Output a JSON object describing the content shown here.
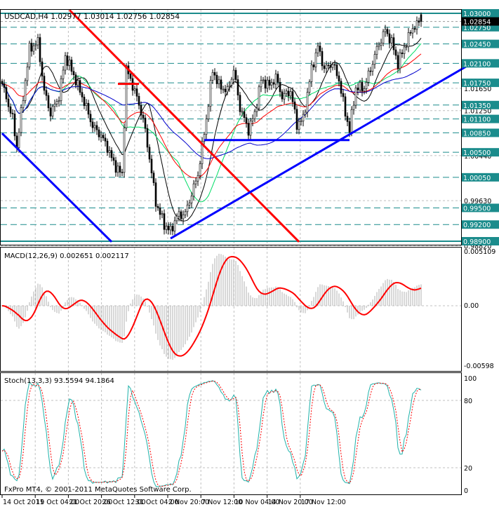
{
  "header": {
    "symbol": "USDCAD,H4",
    "open": "1.02977",
    "high": "1.03014",
    "low": "1.02756",
    "close": "1.02854"
  },
  "macd": {
    "label": "MACD(12,26,9) 0.002651 0.002117",
    "axis": [
      "0.005109",
      "0.00",
      "-0.00598"
    ]
  },
  "stoch": {
    "label": "Stoch(13,3,3) 93.5594 94.1864",
    "axis": [
      "100",
      "80",
      "20",
      "0"
    ]
  },
  "footer": {
    "copyright": "FxPro MT4, © 2001-2011 MetaQuotes Software Corp."
  },
  "colors": {
    "level": "#1b8c8c",
    "candle": "#000000",
    "trend_red": "#ff0000",
    "trend_blue": "#0000ff",
    "macd_hist": "#b0b0b0",
    "macd_signal": "#ff0000",
    "stoch_k": "#20b2aa",
    "stoch_d": "#ff0000",
    "ma_black": "#000000",
    "ma_red": "#ff0000",
    "ma_blue": "#0000cc",
    "ma_green": "#00dd66"
  },
  "chart_data": {
    "type": "candlestick",
    "symbol": "USDCAD",
    "timeframe": "H4",
    "x_tick_labels": [
      "14 Oct 2011",
      "19 Oct 04:00",
      "21 Oct 20:00",
      "26 Oct 12:00",
      "31 Oct 04:00",
      "2 Nov 20:00",
      "7 Nov 12:00",
      "10 Nov 04:00",
      "14 Nov 20:00",
      "17 Nov 12:00"
    ],
    "ylim": [
      0.9882,
      1.0306
    ],
    "current_price": "1.02854",
    "levels": [
      "1.03000",
      "1.02750",
      "1.02450",
      "1.02100",
      "1.01750",
      "1.01350",
      "1.01100",
      "1.00850",
      "1.00500",
      "1.00050",
      "0.99500",
      "0.99200",
      "0.98900"
    ],
    "other_price_labels": [
      "1.01650",
      "1.01250",
      "1.00440",
      "0.99630",
      "0.98820"
    ],
    "close_path": [
      [
        0,
        1.0173
      ],
      [
        5,
        1.011
      ],
      [
        7,
        1.0059
      ],
      [
        10,
        1.015
      ],
      [
        13,
        1.0236
      ],
      [
        17,
        1.0248
      ],
      [
        20,
        1.016
      ],
      [
        23,
        1.012
      ],
      [
        27,
        1.015
      ],
      [
        30,
        1.0223
      ],
      [
        33,
        1.0198
      ],
      [
        37,
        1.016
      ],
      [
        40,
        1.013
      ],
      [
        43,
        1.0097
      ],
      [
        47,
        1.008
      ],
      [
        50,
        1.0059
      ],
      [
        53,
        1.003
      ],
      [
        57,
        1.0009
      ],
      [
        59,
        1.02
      ],
      [
        63,
        1.016
      ],
      [
        67,
        1.011
      ],
      [
        70,
        1.004
      ],
      [
        73,
        0.996
      ],
      [
        77,
        0.992
      ],
      [
        80,
        0.9908
      ],
      [
        83,
        0.9935
      ],
      [
        87,
        0.994
      ],
      [
        90,
        0.9975
      ],
      [
        93,
        1.001
      ],
      [
        97,
        1.011
      ],
      [
        100,
        1.0198
      ],
      [
        103,
        1.017
      ],
      [
        107,
        1.016
      ],
      [
        110,
        1.0198
      ],
      [
        113,
        1.013
      ],
      [
        117,
        1.009
      ],
      [
        120,
        1.012
      ],
      [
        123,
        1.018
      ],
      [
        127,
        1.017
      ],
      [
        130,
        1.0185
      ],
      [
        133,
        1.015
      ],
      [
        137,
        1.016
      ],
      [
        140,
        1.01
      ],
      [
        143,
        1.011
      ],
      [
        147,
        1.02
      ],
      [
        150,
        1.024
      ],
      [
        153,
        1.02
      ],
      [
        157,
        1.021
      ],
      [
        160,
        1.018
      ],
      [
        163,
        1.012
      ],
      [
        165,
        1.0091
      ],
      [
        168,
        1.0166
      ],
      [
        172,
        1.0166
      ],
      [
        175,
        1.02
      ],
      [
        178,
        1.0236
      ],
      [
        182,
        1.027
      ],
      [
        185,
        1.0248
      ],
      [
        188,
        1.021
      ],
      [
        192,
        1.0248
      ],
      [
        195,
        1.0274
      ],
      [
        199,
        1.02854
      ]
    ],
    "trendlines": [
      {
        "color": "red",
        "from": [
          32,
          1.0306
        ],
        "to": [
          141,
          0.9889
        ]
      },
      {
        "color": "blue",
        "from": [
          0,
          1.0084
        ],
        "to": [
          52,
          0.9889
        ]
      },
      {
        "color": "blue",
        "from": [
          80,
          0.9895
        ],
        "to": [
          223,
          1.021
        ]
      },
      {
        "color": "blue",
        "from": [
          96,
          1.0072
        ],
        "to": [
          165,
          1.0072
        ]
      },
      {
        "color": "red",
        "from": [
          55,
          1.0173
        ],
        "to": [
          65,
          1.0173
        ]
      }
    ],
    "indicators": {
      "macd": [
        12,
        26,
        9
      ],
      "stochastic": [
        13,
        3,
        3
      ],
      "stoch_levels": [
        20,
        80
      ]
    }
  }
}
